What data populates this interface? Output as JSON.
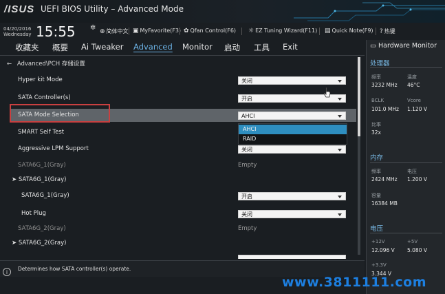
{
  "app": {
    "logo": "/ISUS",
    "title": "UEFI BIOS Utility – Advanced Mode"
  },
  "infobar": {
    "date": "04/20/2016",
    "weekday": "Wednesday",
    "time": "15:55",
    "tools": {
      "language": "简体中文",
      "myfavorite": "MyFavorite(F3)",
      "qfan": "Qfan Control(F6)",
      "ez_tuning": "EZ Tuning Wizard(F11)",
      "quick_note": "Quick Note(F9)",
      "hotkeys": "热键"
    }
  },
  "menu": {
    "favorites": "收藏夹",
    "overview": "概要",
    "ai_tweaker": "Ai Tweaker",
    "advanced": "Advanced",
    "monitor": "Monitor",
    "boot": "启动",
    "tool": "工具",
    "exit": "Exit"
  },
  "breadcrumb": "Advanced\\PCH 存储设置",
  "settings": {
    "hyper_kit": {
      "label": "Hyper kit Mode",
      "value": "关闭"
    },
    "sata_controller": {
      "label": "SATA Controller(s)",
      "value": "开启"
    },
    "sata_mode": {
      "label": "SATA Mode Selection",
      "value": "AHCI",
      "options": [
        "AHCI",
        "RAID"
      ]
    },
    "smart_self_test": {
      "label": "SMART Self Test"
    },
    "lpm": {
      "label": "Aggressive LPM Support",
      "value": "关闭"
    },
    "sata6g1_info": {
      "label": "SATA6G_1(Gray)",
      "value": "Empty"
    },
    "sata6g1_group": {
      "label": "SATA6G_1(Gray)"
    },
    "sata6g1_port": {
      "label": "SATA6G_1(Gray)",
      "value": "开启"
    },
    "hot_plug": {
      "label": "Hot Plug",
      "value": "关闭"
    },
    "sata6g2_info": {
      "label": "SATA6G_2(Gray)",
      "value": "Empty"
    },
    "sata6g2_group": {
      "label": "SATA6G_2(Gray)"
    }
  },
  "status": {
    "help_text": "Determines how SATA controller(s) operate."
  },
  "hardware_monitor": {
    "title": "Hardware Monitor",
    "cpu": {
      "title": "处理器",
      "freq_label": "频率",
      "freq": "3232 MHz",
      "temp_label": "温度",
      "temp": "46°C",
      "bclk_label": "BCLK",
      "bclk": "101.0 MHz",
      "vcore_label": "Vcore",
      "vcore": "1.120 V",
      "ratio_label": "比率",
      "ratio": "32x"
    },
    "memory": {
      "title": "内存",
      "freq_label": "频率",
      "freq": "2424 MHz",
      "volt_label": "电压",
      "volt": "1.200 V",
      "cap_label": "容量",
      "cap": "16384 MB"
    },
    "voltage": {
      "title": "电压",
      "v12_label": "+12V",
      "v12": "12.096 V",
      "v5_label": "+5V",
      "v5": "5.080 V",
      "v33_label": "+3.3V",
      "v33": "3.344 V"
    }
  },
  "watermark": "www.3811111.com",
  "colors": {
    "accent": "#6cb3e6",
    "selected_option": "#2e8ec0",
    "highlight_box": "#c94040",
    "watermark": "#1d7fe0"
  },
  "scroll": {
    "position_fraction": 0.0,
    "visible_fraction": 0.4
  }
}
